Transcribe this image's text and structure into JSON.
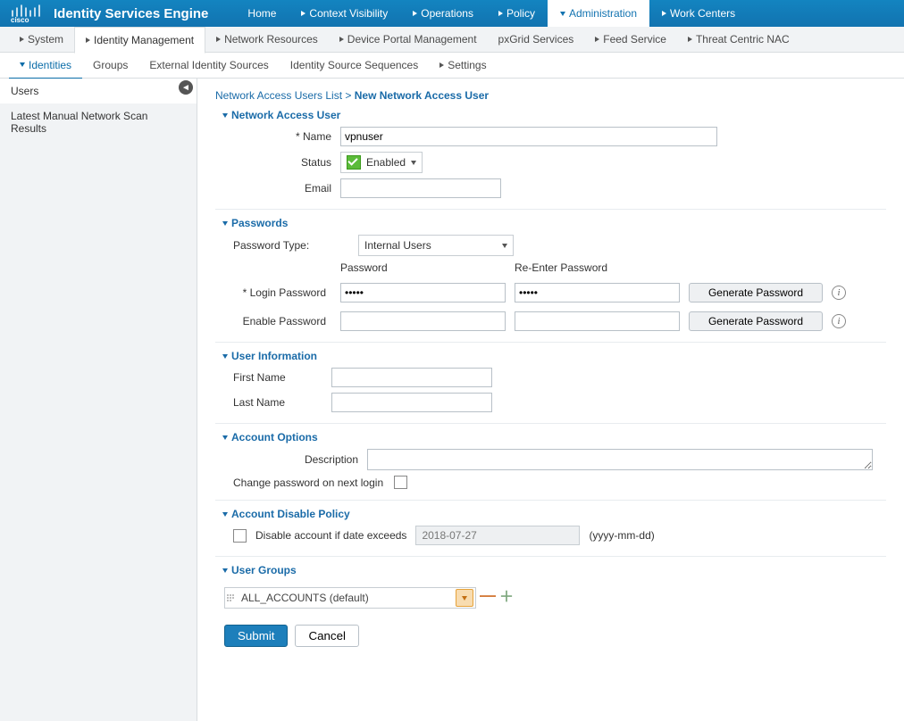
{
  "header": {
    "brand": "cisco",
    "app_title": "Identity Services Engine",
    "nav": [
      "Home",
      "Context Visibility",
      "Operations",
      "Policy",
      "Administration",
      "Work Centers"
    ],
    "nav_active": "Administration"
  },
  "subnav": {
    "items": [
      "System",
      "Identity Management",
      "Network Resources",
      "Device Portal Management",
      "pxGrid Services",
      "Feed Service",
      "Threat Centric NAC"
    ],
    "active": "Identity Management",
    "no_caret": [
      "pxGrid Services"
    ]
  },
  "ternav": {
    "items": [
      "Identities",
      "Groups",
      "External Identity Sources",
      "Identity Source Sequences",
      "Settings"
    ],
    "active": "Identities",
    "caret_items": [
      "Identities",
      "Settings"
    ]
  },
  "sidebar": [
    "Users",
    "Latest Manual Network Scan Results"
  ],
  "sidebar_active": "Users",
  "breadcrumb": {
    "list": "Network Access Users List",
    "sep": ">",
    "current": "New Network Access User"
  },
  "sections": {
    "main_title": "Network Access User",
    "name_label": "* Name",
    "name_value": "vpnuser",
    "status_label": "Status",
    "status_value": "Enabled",
    "email_label": "Email",
    "email_value": "",
    "passwords": {
      "title": "Passwords",
      "type_label": "Password Type:",
      "type_value": "Internal Users",
      "col1": "Password",
      "col2": "Re-Enter Password",
      "login_label": "* Login Password",
      "login_pw": "•••••",
      "login_pw2": "•••••",
      "enable_label": "Enable Password",
      "enable_pw": "",
      "enable_pw2": "",
      "gen_btn": "Generate Password"
    },
    "userinfo": {
      "title": "User Information",
      "first_label": "First Name",
      "first_value": "",
      "last_label": "Last Name",
      "last_value": ""
    },
    "options": {
      "title": "Account Options",
      "desc_label": "Description",
      "desc_value": "",
      "change_pw_label": "Change password on next login"
    },
    "disable": {
      "title": "Account Disable Policy",
      "label": "Disable account if date exceeds",
      "date": "2018-07-27",
      "hint": "(yyyy-mm-dd)"
    },
    "groups": {
      "title": "User Groups",
      "value": "ALL_ACCOUNTS (default)"
    },
    "submit": "Submit",
    "cancel": "Cancel"
  }
}
